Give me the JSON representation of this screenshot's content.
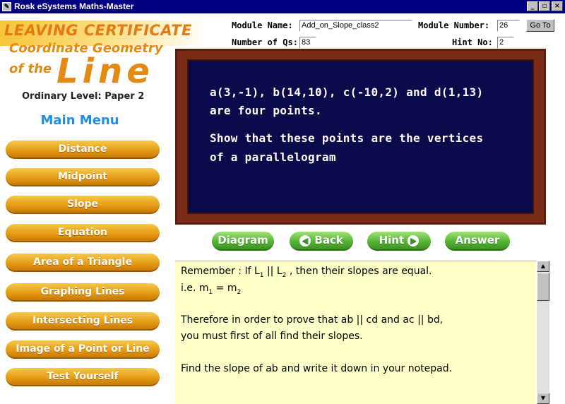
{
  "window": {
    "title": "Rosk eSystems Maths-Master"
  },
  "brand": {
    "leaving_cert": "LEAVING CERTIFICATE",
    "topic_line1": "Coordinate Geometry",
    "of_the": "of the",
    "line": "Line",
    "level": "Ordinary Level: Paper 2"
  },
  "menu": {
    "title": "Main Menu",
    "items": [
      "Distance",
      "Midpoint",
      "Slope",
      "Equation",
      "Area of a Triangle",
      "Graphing Lines",
      "Intersecting Lines",
      "Image of a Point or Line",
      "Test Yourself"
    ]
  },
  "header": {
    "module_name_label": "Module Name:",
    "module_name": "Add_on_Slope_class2",
    "module_number_label": "Module Number:",
    "module_number": "26",
    "goto": "Go To",
    "num_qs_label": "Number of Qs:",
    "num_qs": "83",
    "hint_no_label": "Hint No:",
    "hint_no": "2"
  },
  "question": {
    "line1": "a(3,-1), b(14,10), c(-10,2) and d(1,13)",
    "line2": "are four points.",
    "line3": "Show that these points are the vertices",
    "line4": "of a parallelogram"
  },
  "actions": {
    "diagram": "Diagram",
    "back": "Back",
    "hint": "Hint",
    "answer": "Answer"
  },
  "hint": {
    "l1a": "Remember : If L",
    "l1_sub1": "1",
    "l1b": " || L",
    "l1_sub2": "2",
    "l1c": " , then their slopes are equal.",
    "l2a": "i.e. m",
    "l2_sub1": "1",
    "l2b": " = m",
    "l2_sub2": "2",
    "l3": "Therefore in order to prove that ab || cd and ac || bd,",
    "l4": "you must first of all find their slopes.",
    "l5": "Find the slope of ab and write it down in your notepad."
  }
}
